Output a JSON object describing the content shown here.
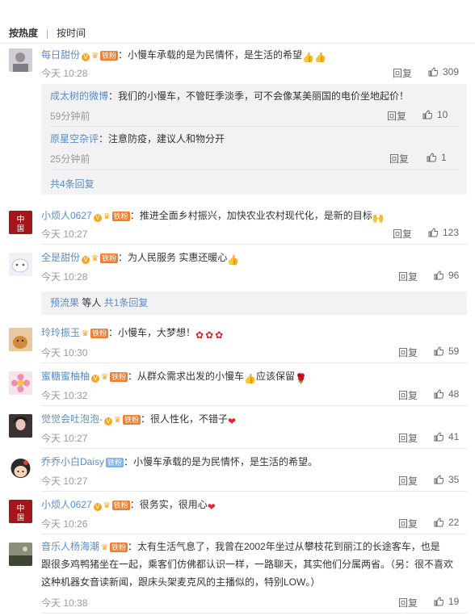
{
  "tabs": {
    "hot": "按热度",
    "time": "按时间"
  },
  "fans_label": "铁粉",
  "reply_label": "回复",
  "comments": [
    {
      "user": "每日甜份",
      "text": "：小慢车承载的是为民情怀，是生活的希望",
      "time": "今天 10:28",
      "likes": "309"
    },
    {
      "user": "小烦人0627",
      "text": "：推进全面乡村振兴，加快农业农村现代化，是新的目标",
      "time": "今天 10:27",
      "likes": "123"
    },
    {
      "user": "全是甜份",
      "text": "：为人民服务 实惠还暖心",
      "time": "今天 10:28",
      "likes": "96"
    },
    {
      "user": "玲玲振玉",
      "text": "：小慢车，大梦想！",
      "time": "今天 10:30",
      "likes": "59"
    },
    {
      "user": "蜜糖蜜柚柚",
      "text": "：从群众需求出发的小慢车",
      "text2": "应该保留",
      "time": "今天 10:32",
      "likes": "48"
    },
    {
      "user": "觉觉会吐泡泡-",
      "text": "：很人性化，不错子",
      "time": "今天 10:27",
      "likes": "41"
    },
    {
      "user": "乔乔小白Daisy",
      "text": "：小慢车承载的是为民情怀，是生活的希望。",
      "time": "今天 10:27",
      "likes": "35"
    },
    {
      "user": "小烦人0627",
      "text": "：很务实，很用心",
      "time": "今天 10:26",
      "likes": "22"
    },
    {
      "user": "音乐人杨海潮",
      "text": "：太有生活气息了，我曾在2002年坐过从攀枝花到丽江的长途客车，也是",
      "text2": "跟很多鸡鸭猪坐在一起，乘客们仿佛都认识一样，一路聊天，其实他们分属两省。（另：很不喜欢",
      "text3": "这种机器女音读新闻，跟床头架麦克风的主播似的，特别LOW。）",
      "time": "今天 10:38",
      "likes": "19"
    }
  ],
  "subreplies1": [
    {
      "user": "成太树的微博",
      "text": "：我们的小慢车，不管旺季淡季，可不会像某美丽国的电价坐地起价！",
      "time": "59分钟前",
      "likes": "10"
    },
    {
      "user": "原星空杂评",
      "text": "：注意防疫，建议人和物分开",
      "time": "25分钟前",
      "likes": "1"
    }
  ],
  "more1": "共4条回复",
  "sub3": {
    "user": "预流果",
    "mid": " 等人 ",
    "more": "共1条回复"
  }
}
